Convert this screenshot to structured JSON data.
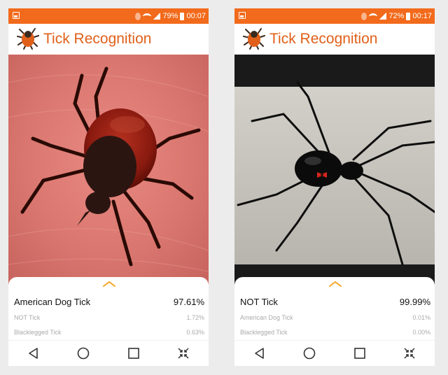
{
  "screens": [
    {
      "status": {
        "battery": "79%",
        "time": "00:07"
      },
      "app_title": "Tick Recognition",
      "results": {
        "top": {
          "label": "American Dog Tick",
          "value": "97.61%"
        },
        "others": [
          {
            "label": "NOT Tick",
            "value": "1.72%"
          },
          {
            "label": "Blacklegged Tick",
            "value": "0.63%"
          }
        ]
      }
    },
    {
      "status": {
        "battery": "72%",
        "time": "00:17"
      },
      "app_title": "Tick Recognition",
      "results": {
        "top": {
          "label": "NOT Tick",
          "value": "99.99%"
        },
        "others": [
          {
            "label": "American Dog Tick",
            "value": "0.01%"
          },
          {
            "label": "Blacklegged Tick",
            "value": "0.00%"
          }
        ]
      }
    }
  ],
  "colors": {
    "accent": "#f26a1b",
    "title": "#e0601a"
  },
  "icons": {
    "status": [
      "gallery-icon",
      "bluetooth-icon",
      "wifi-icon",
      "signal-icon",
      "battery-icon"
    ],
    "nav": [
      "back-icon",
      "home-icon",
      "recents-icon",
      "collapse-icon"
    ]
  }
}
